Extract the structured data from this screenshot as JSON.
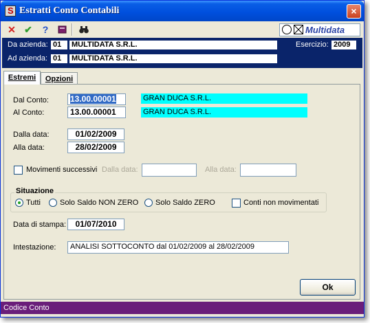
{
  "window": {
    "title": "Estratti Conto Contabili",
    "close_glyph": "×"
  },
  "toolbar": {
    "icons": [
      "close-x-icon",
      "check-icon",
      "help-icon",
      "book-icon",
      "binoculars-icon"
    ],
    "logo_text": "Multidata"
  },
  "header": {
    "from_company_label": "Da azienda:",
    "from_company_code": "01",
    "from_company_name": "MULTIDATA S.R.L.",
    "to_company_label": "Ad azienda:",
    "to_company_code": "01",
    "to_company_name": "MULTIDATA S.R.L.",
    "fiscal_year_label": "Esercizio:",
    "fiscal_year": "2009"
  },
  "tabs": [
    {
      "label": "Estremi",
      "active": true
    },
    {
      "label": "Opzioni",
      "active": false
    }
  ],
  "form": {
    "from_account_label": "Dal Conto:",
    "from_account_value": "13.00.00001",
    "from_account_name": "GRAN DUCA S.R.L.",
    "to_account_label": "Al Conto:",
    "to_account_value": "13.00.00001",
    "to_account_name": "GRAN DUCA S.R.L.",
    "from_date_label": "Dalla data:",
    "from_date_value": "01/02/2009",
    "to_date_label": "Alla data:",
    "to_date_value": "28/02/2009",
    "later_movements_label": "Movimenti successivi",
    "later_from_date_label": "Dalla data:",
    "later_from_date_value": "",
    "later_to_date_label": "Alla data:",
    "later_to_date_value": "",
    "situation": {
      "title": "Situazione",
      "options": [
        "Tutti",
        "Solo Saldo NON ZERO",
        "Solo Saldo ZERO"
      ],
      "selected": "Tutti",
      "unmoved_accounts_label": "Conti non movimentati"
    },
    "print_date_label": "Data di stampa:",
    "print_date_value": "01/07/2010",
    "heading_label": "Intestazione:",
    "heading_value": "ANALISI SOTTOCONTO dal 01/02/2009 al 28/02/2009",
    "ok_label": "Ok"
  },
  "status_bar": {
    "text": "Codice Conto"
  },
  "colors": {
    "title_bar": "#0054e3",
    "header_band": "#0a246a",
    "account_name_bg": "#00ffff",
    "status_bar": "#6a1e7a"
  }
}
